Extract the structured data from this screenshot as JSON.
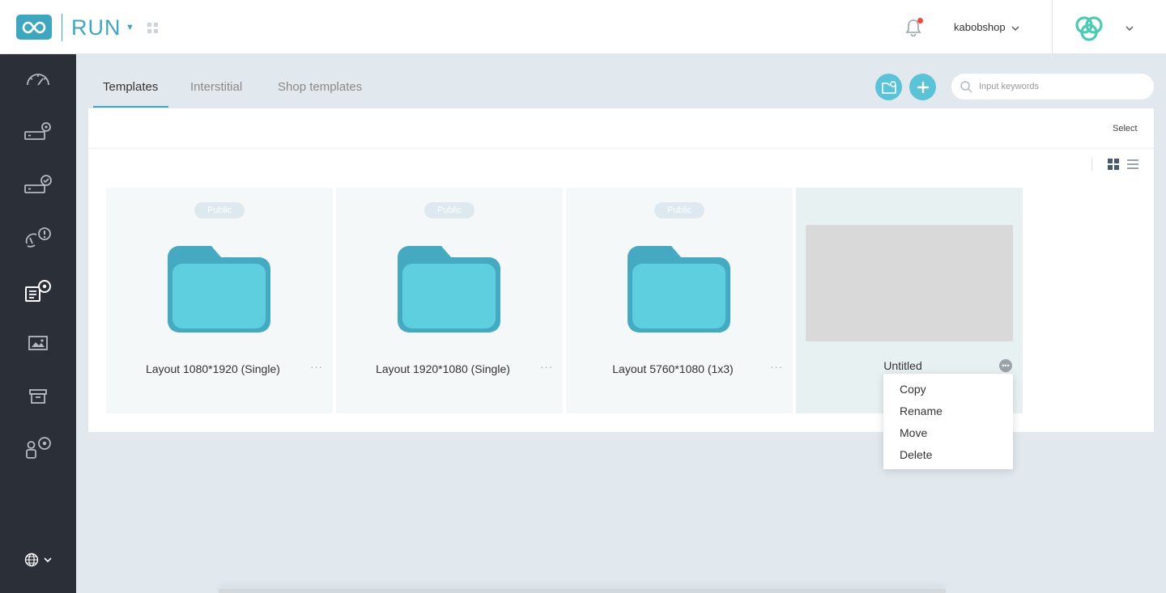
{
  "header": {
    "app_name": "RUN",
    "username": "kabobshop"
  },
  "sidebar": {
    "items": [
      {
        "icon": "dashboard-gauge-icon"
      },
      {
        "icon": "device-settings-icon"
      },
      {
        "icon": "device-check-icon"
      },
      {
        "icon": "alert-monitor-icon"
      },
      {
        "icon": "template-settings-icon",
        "active": true
      },
      {
        "icon": "media-image-icon"
      },
      {
        "icon": "archive-box-icon"
      },
      {
        "icon": "user-settings-icon"
      }
    ],
    "language_icon": "globe-icon"
  },
  "tabs": [
    {
      "label": "Templates",
      "active": true
    },
    {
      "label": "Interstitial"
    },
    {
      "label": "Shop templates"
    }
  ],
  "search": {
    "placeholder": "Input keywords",
    "value": ""
  },
  "toolbar": {
    "select_label": "Select"
  },
  "cards": [
    {
      "badge": "Public",
      "label": "Layout 1080*1920 (Single)",
      "type": "folder"
    },
    {
      "badge": "Public",
      "label": "Layout 1920*1080 (Single)",
      "type": "folder"
    },
    {
      "badge": "Public",
      "label": "Layout 5760*1080 (1x3)",
      "type": "folder"
    },
    {
      "label": "Untitled",
      "type": "template"
    }
  ],
  "context_menu": {
    "items": [
      "Copy",
      "Rename",
      "Move",
      "Delete"
    ]
  },
  "colors": {
    "accent": "#3fa6c0",
    "sidebar_bg": "#2b2f38",
    "page_bg": "#e2e9ee",
    "folder": "#5ecfde",
    "folder_dark": "#46a9c2",
    "notification": "#e74c3c"
  }
}
